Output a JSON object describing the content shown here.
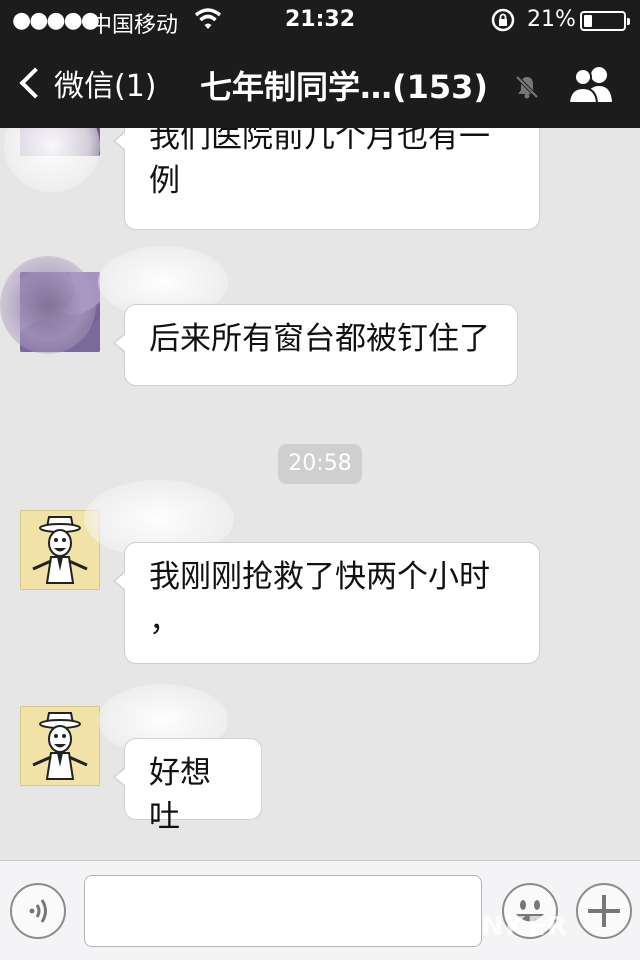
{
  "status_bar": {
    "signal": "●●●●●",
    "carrier": "中国移动",
    "time": "21:32",
    "battery_pct": "21%",
    "battery_level": 0.21
  },
  "nav": {
    "back_label": "微信(1)",
    "title": "七年制同学…(153)"
  },
  "chat": {
    "timestamp": "20:58",
    "messages": [
      {
        "lines": [
          "我们医院前几个月也有一",
          "例"
        ]
      },
      {
        "lines": [
          "后来所有窗台都被钉住了"
        ]
      },
      {
        "lines": [
          "我刚刚抢救了快两个小时",
          "，"
        ]
      },
      {
        "lines": [
          "好想吐"
        ]
      }
    ]
  },
  "watermark": "MEDLINKER"
}
